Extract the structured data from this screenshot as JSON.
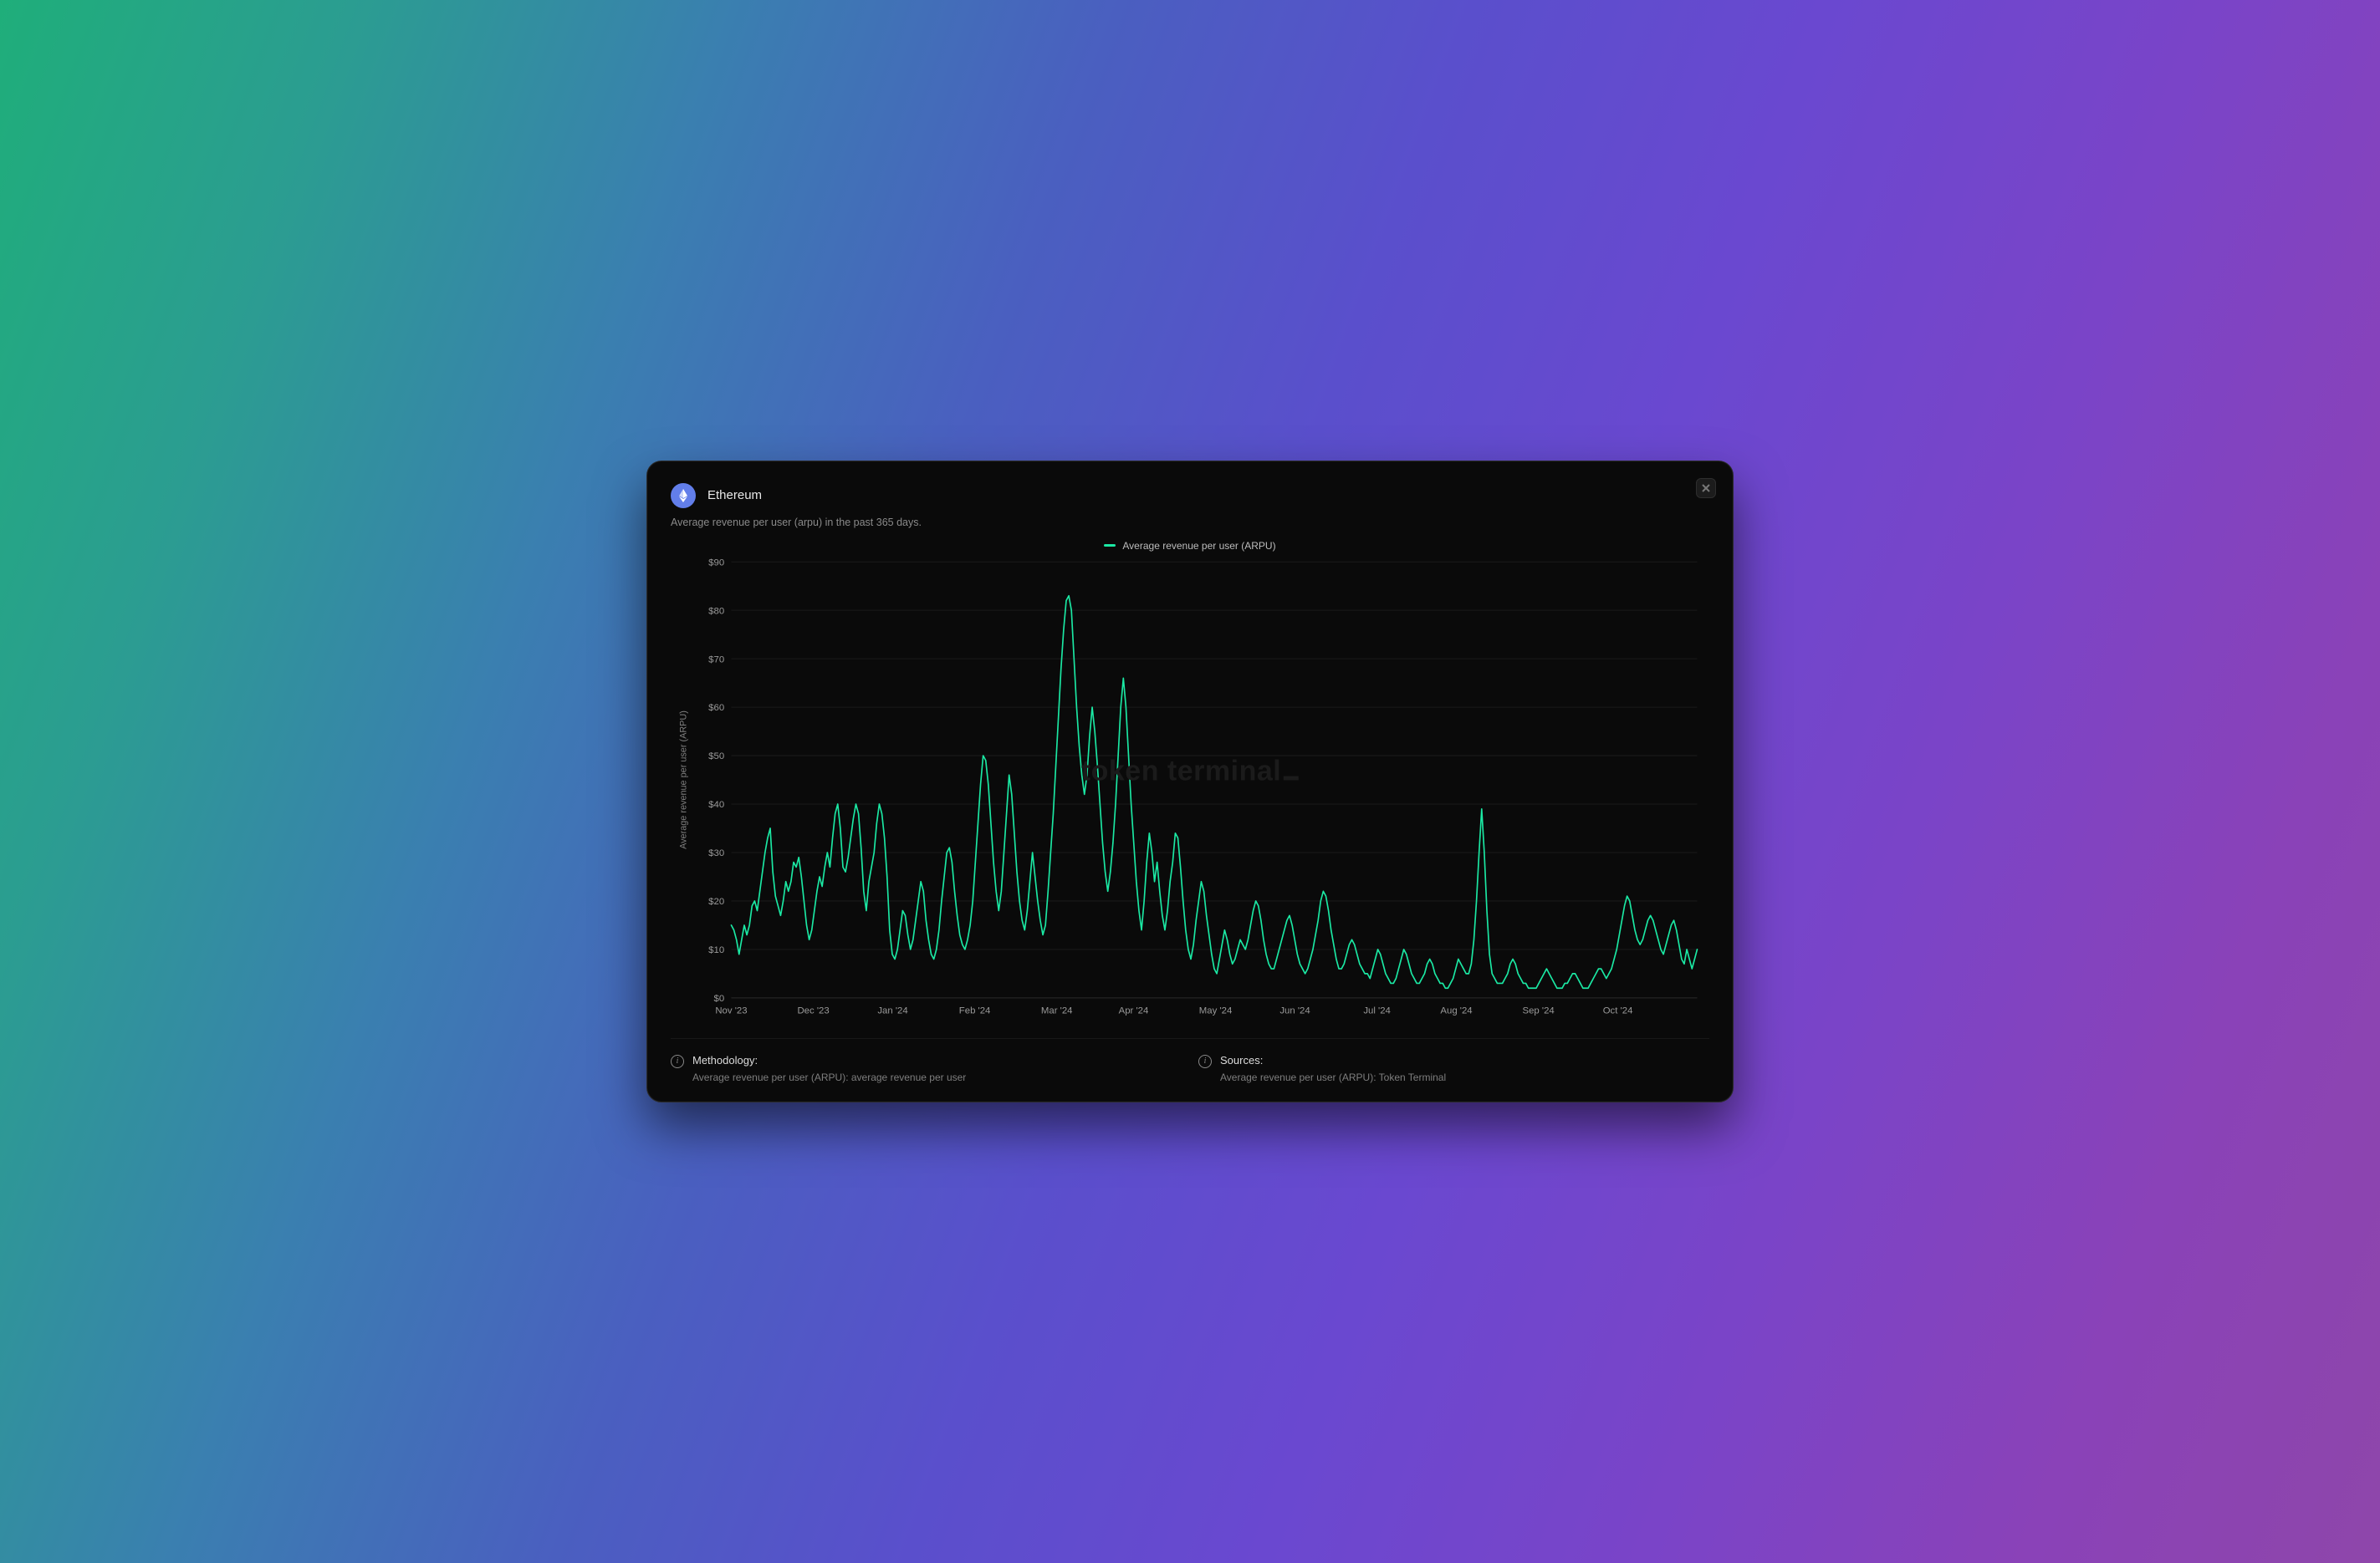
{
  "header": {
    "title": "Ethereum",
    "subtitle": "Average revenue per user (arpu) in the past 365 days."
  },
  "legend": {
    "label": "Average revenue per user (ARPU)"
  },
  "watermark": "token terminal",
  "colors": {
    "series": "#1be9a4"
  },
  "footer": {
    "methodology": {
      "title": "Methodology:",
      "body": "Average revenue per user (ARPU): average revenue per user"
    },
    "sources": {
      "title": "Sources:",
      "body": "Average revenue per user (ARPU): Token Terminal"
    }
  },
  "chart_data": {
    "type": "line",
    "title": "",
    "xlabel": "",
    "ylabel": "Average revenue per user (ARPU)",
    "ylim": [
      0,
      90
    ],
    "y_ticks": [
      0,
      10,
      20,
      30,
      40,
      50,
      60,
      70,
      80,
      90
    ],
    "y_tick_labels": [
      "$0",
      "$10",
      "$20",
      "$30",
      "$40",
      "$50",
      "$60",
      "$70",
      "$80",
      "$90"
    ],
    "x_tick_labels": [
      "Nov '23",
      "Dec '23",
      "Jan '24",
      "Feb '24",
      "Mar '24",
      "Apr '24",
      "May '24",
      "Jun '24",
      "Jul '24",
      "Aug '24",
      "Sep '24",
      "Oct '24"
    ],
    "x_tick_positions": [
      0,
      31,
      61,
      92,
      123,
      152,
      183,
      213,
      244,
      274,
      305,
      335
    ],
    "series": [
      {
        "name": "Average revenue per user (ARPU)",
        "color": "#1be9a4",
        "values": [
          15,
          14,
          12,
          9,
          12,
          15,
          13,
          15,
          19,
          20,
          18,
          22,
          26,
          30,
          33,
          35,
          26,
          21,
          19,
          17,
          20,
          24,
          22,
          24,
          28,
          27,
          29,
          25,
          20,
          15,
          12,
          14,
          18,
          22,
          25,
          23,
          27,
          30,
          27,
          33,
          38,
          40,
          35,
          27,
          26,
          29,
          33,
          37,
          40,
          38,
          31,
          22,
          18,
          24,
          27,
          30,
          36,
          40,
          38,
          33,
          25,
          14,
          9,
          8,
          10,
          14,
          18,
          17,
          13,
          10,
          12,
          16,
          20,
          24,
          22,
          16,
          12,
          9,
          8,
          10,
          14,
          20,
          25,
          30,
          31,
          28,
          22,
          17,
          13,
          11,
          10,
          12,
          15,
          20,
          28,
          36,
          44,
          50,
          49,
          44,
          36,
          28,
          22,
          18,
          22,
          30,
          38,
          46,
          42,
          34,
          26,
          20,
          16,
          14,
          18,
          24,
          30,
          25,
          20,
          16,
          13,
          15,
          22,
          30,
          38,
          48,
          58,
          68,
          76,
          82,
          83,
          80,
          70,
          60,
          52,
          46,
          42,
          46,
          54,
          60,
          55,
          48,
          40,
          32,
          26,
          22,
          26,
          32,
          40,
          50,
          60,
          66,
          60,
          50,
          40,
          32,
          24,
          18,
          14,
          20,
          28,
          34,
          30,
          24,
          28,
          22,
          17,
          14,
          18,
          24,
          28,
          34,
          33,
          27,
          20,
          14,
          10,
          8,
          11,
          16,
          20,
          24,
          22,
          17,
          13,
          9,
          6,
          5,
          8,
          11,
          14,
          12,
          9,
          7,
          8,
          10,
          12,
          11,
          10,
          12,
          15,
          18,
          20,
          19,
          16,
          12,
          9,
          7,
          6,
          6,
          8,
          10,
          12,
          14,
          16,
          17,
          15,
          12,
          9,
          7,
          6,
          5,
          6,
          8,
          10,
          13,
          16,
          20,
          22,
          21,
          18,
          14,
          11,
          8,
          6,
          6,
          7,
          9,
          11,
          12,
          11,
          9,
          7,
          6,
          5,
          5,
          4,
          6,
          8,
          10,
          9,
          7,
          5,
          4,
          3,
          3,
          4,
          6,
          8,
          10,
          9,
          7,
          5,
          4,
          3,
          3,
          4,
          5,
          7,
          8,
          7,
          5,
          4,
          3,
          3,
          2,
          2,
          3,
          4,
          6,
          8,
          7,
          6,
          5,
          5,
          7,
          12,
          20,
          30,
          39,
          30,
          18,
          9,
          5,
          4,
          3,
          3,
          3,
          4,
          5,
          7,
          8,
          7,
          5,
          4,
          3,
          3,
          2,
          2,
          2,
          2,
          3,
          4,
          5,
          6,
          5,
          4,
          3,
          2,
          2,
          2,
          3,
          3,
          4,
          5,
          5,
          4,
          3,
          2,
          2,
          2,
          3,
          4,
          5,
          6,
          6,
          5,
          4,
          5,
          6,
          8,
          10,
          13,
          16,
          19,
          21,
          20,
          17,
          14,
          12,
          11,
          12,
          14,
          16,
          17,
          16,
          14,
          12,
          10,
          9,
          11,
          13,
          15,
          16,
          14,
          11,
          8,
          7,
          10,
          8,
          6,
          8,
          10
        ]
      }
    ]
  }
}
